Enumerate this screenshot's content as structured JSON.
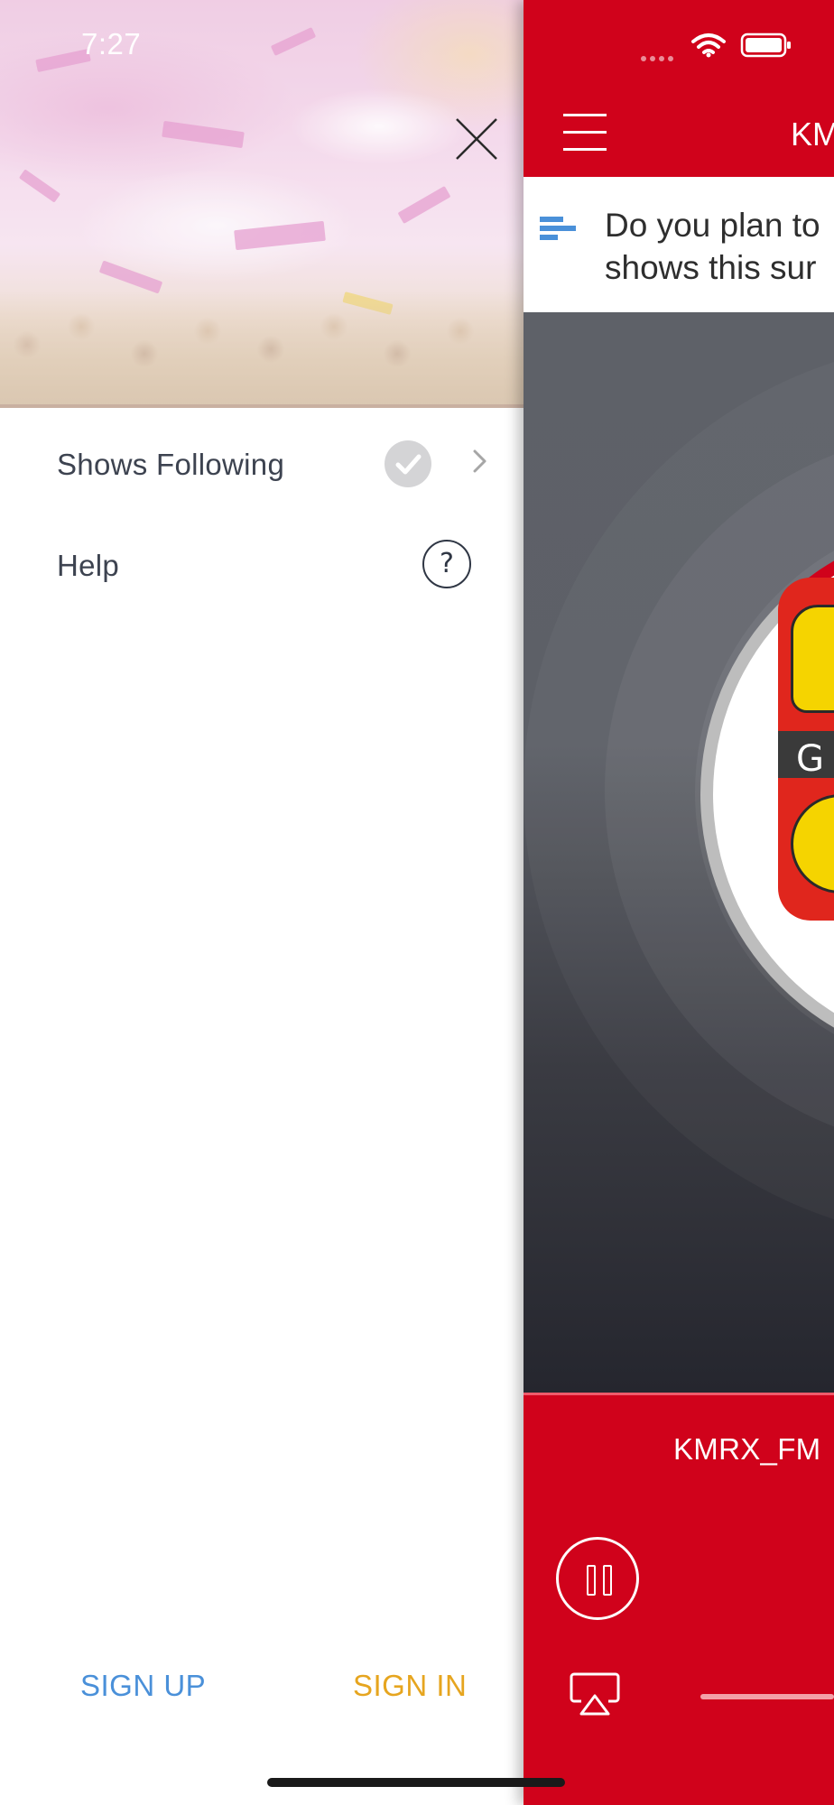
{
  "status_bar": {
    "time": "7:27"
  },
  "drawer": {
    "close_icon": "close-icon",
    "menu": [
      {
        "label": "Shows Following",
        "icon": "check-circle-icon",
        "trailing_icon": "chevron-right-icon"
      },
      {
        "label": "Help",
        "icon": "question-circle-icon",
        "trailing_icon": ""
      }
    ],
    "sign_up_label": "SIGN UP",
    "sign_in_label": "SIGN IN"
  },
  "app": {
    "title": "KM",
    "menu_icon": "hamburger-icon",
    "poll": {
      "icon": "poll-bars-icon",
      "text_line1": "Do you plan to",
      "text_line2": "shows this sur"
    },
    "now_playing": {
      "station": "KMRX_FM",
      "logo_letter": "G",
      "pause_icon": "pause-icon",
      "airplay_icon": "airplay-icon"
    }
  },
  "colors": {
    "brand_red": "#d0021b",
    "sign_up": "#4a90d9",
    "sign_in": "#e6a51f",
    "menu_text": "#3d4350"
  }
}
